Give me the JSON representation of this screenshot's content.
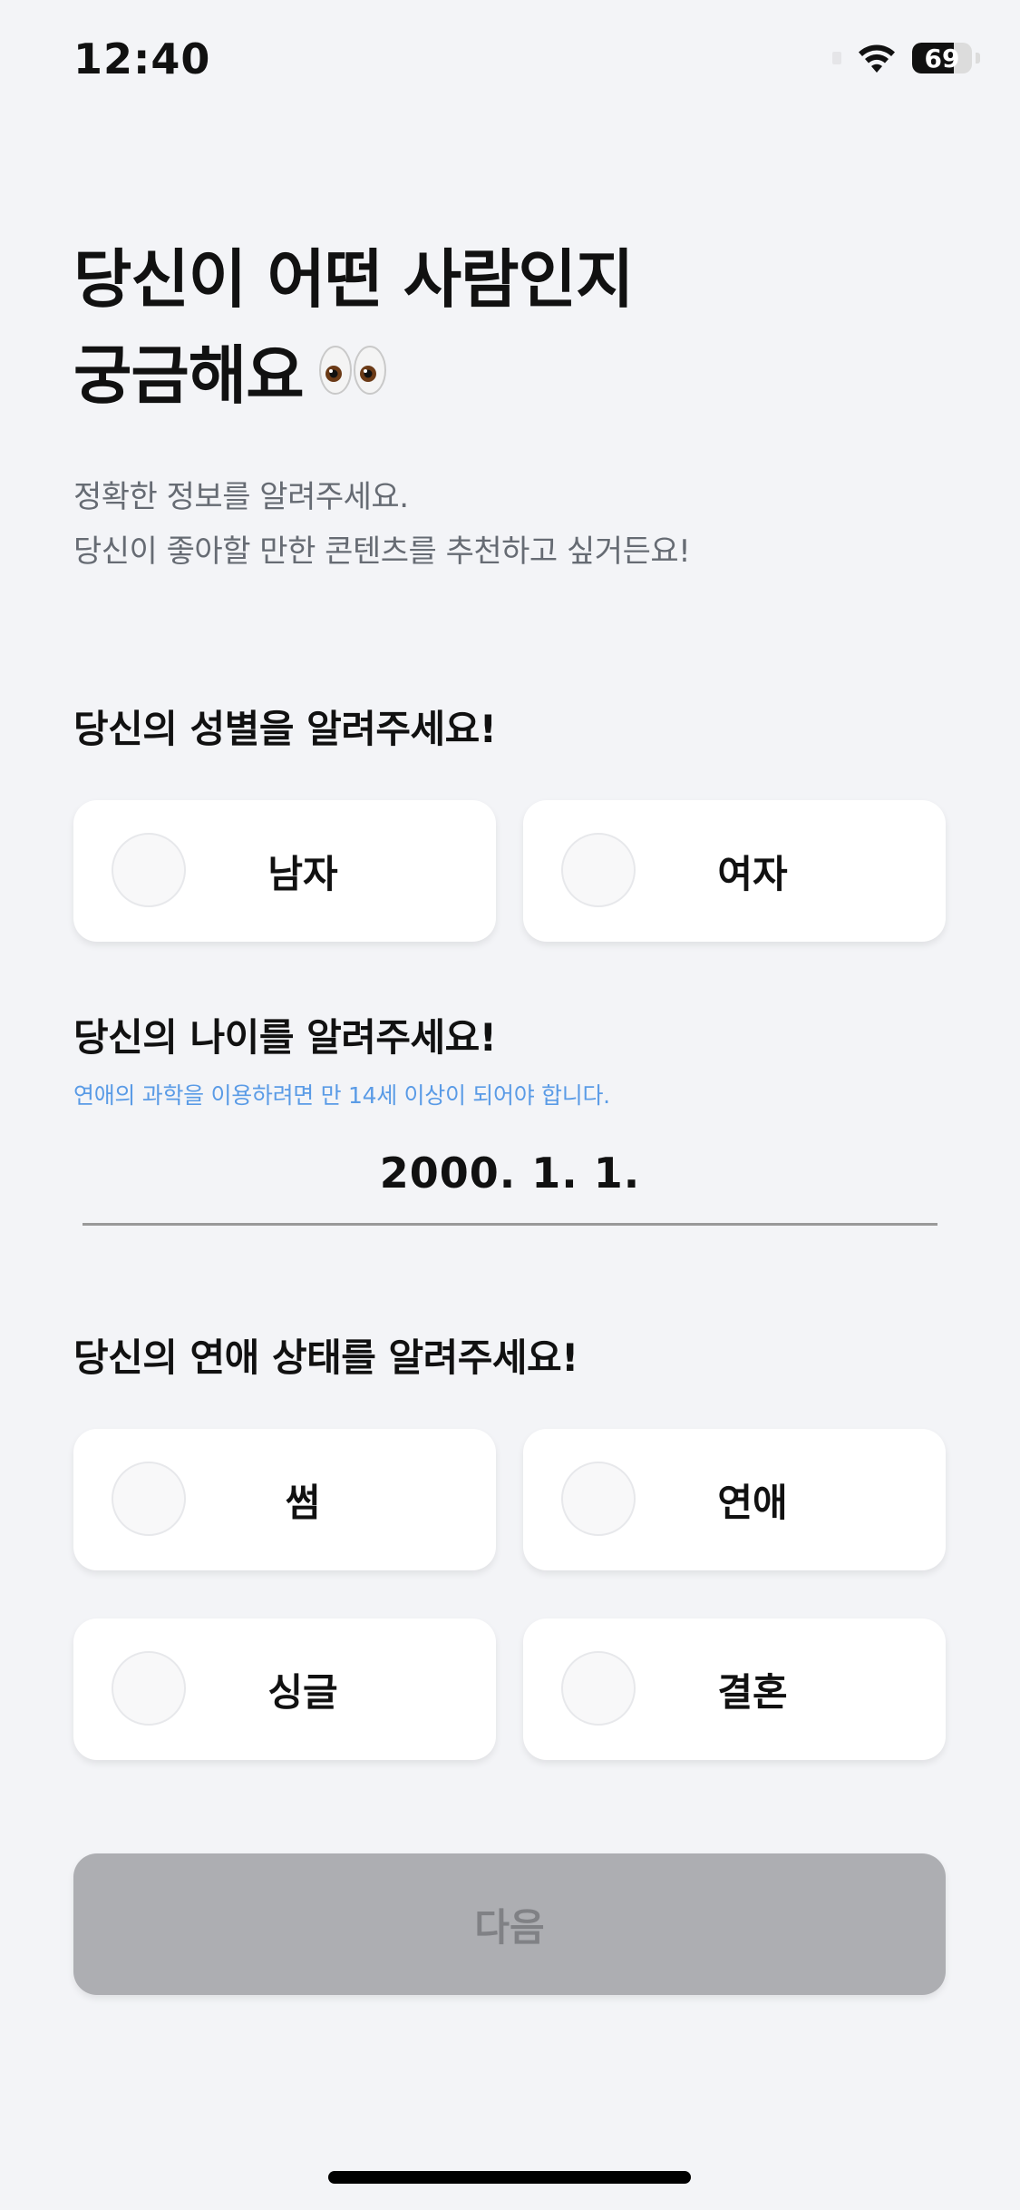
{
  "status_bar": {
    "time": "12:40",
    "battery_level": "69"
  },
  "title": {
    "line1": "당신이 어떤 사람인지",
    "line2": "궁금해요"
  },
  "subtitle": {
    "line1": "정확한 정보를 알려주세요.",
    "line2": "당신이 좋아할 만한 콘텐츠를 추천하고 싶거든요!"
  },
  "gender_section": {
    "label": "당신의 성별을 알려주세요!",
    "options": [
      "남자",
      "여자"
    ]
  },
  "age_section": {
    "label": "당신의 나이를 알려주세요!",
    "note": "연애의 과학을 이용하려면 만 14세 이상이 되어야 합니다.",
    "date_value": "2000. 1. 1."
  },
  "relationship_section": {
    "label": "당신의 연애 상태를 알려주세요!",
    "options": [
      "썸",
      "연애",
      "싱글",
      "결혼"
    ]
  },
  "next_button": {
    "label": "다음",
    "enabled": false
  },
  "colors": {
    "background": "#f3f4f7",
    "accent_note": "#5a9be6",
    "button_disabled": "#adaeb2"
  }
}
